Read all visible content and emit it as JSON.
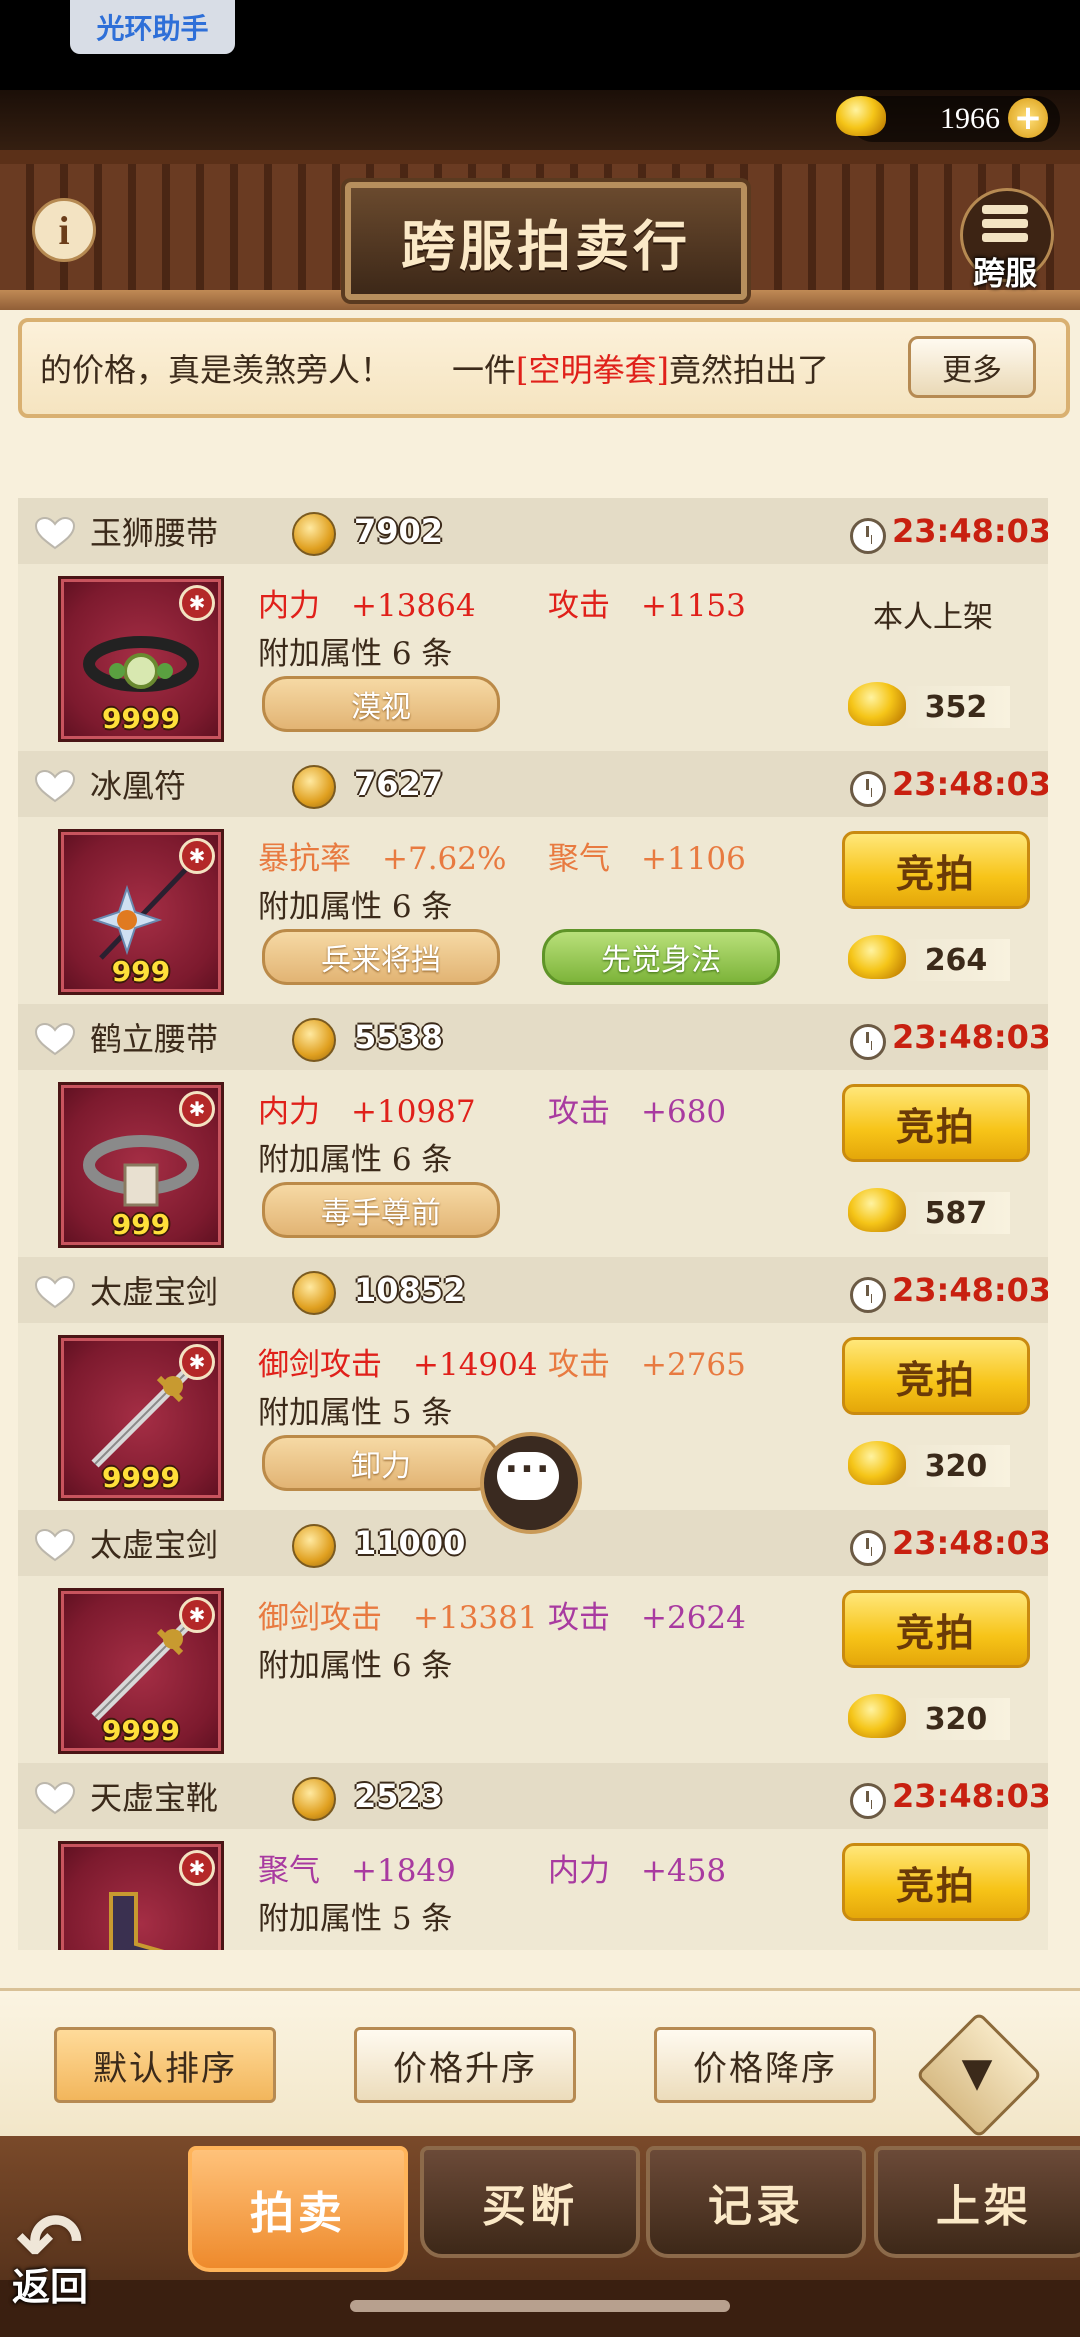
{
  "helper": "光环助手",
  "currency": {
    "gold": "1966",
    "plus": "+"
  },
  "header": {
    "title": "跨服拍卖行",
    "info": "i",
    "cross_server_label": "跨服"
  },
  "marquee": {
    "text_a": "的价格，真是羡煞旁人！",
    "text_b": "一件",
    "text_highlight": "[空明拳套]",
    "text_c": "竟然拍出了",
    "more_label": "更多"
  },
  "items": [
    {
      "name": "玉狮腰带",
      "price": "7902",
      "time": "23:48:03",
      "qty": "9999",
      "stat1": "内力　+13864",
      "stat1_color": "#e0201a",
      "stat2": "攻击　+1153",
      "stat2_color": "#e0201a",
      "extra": "附加属性 6 条",
      "tag1": "漠视",
      "tag2": "",
      "action": "本人上架",
      "bid_price": "352"
    },
    {
      "name": "冰凰符",
      "price": "7627",
      "time": "23:48:03",
      "qty": "999",
      "stat1": "暴抗率　+7.62%",
      "stat1_color": "#e87a40",
      "stat2": "聚气　+1106",
      "stat2_color": "#e87a40",
      "extra": "附加属性 6 条",
      "tag1": "兵来将挡",
      "tag2": "先觉身法",
      "action": "竞拍",
      "bid_price": "264"
    },
    {
      "name": "鹤立腰带",
      "price": "5538",
      "time": "23:48:03",
      "qty": "999",
      "stat1": "内力　+10987",
      "stat1_color": "#e0201a",
      "stat2": "攻击　+680",
      "stat2_color": "#a83aa0",
      "extra": "附加属性 6 条",
      "tag1": "毒手尊前",
      "tag2": "",
      "action": "竞拍",
      "bid_price": "587"
    },
    {
      "name": "太虚宝剑",
      "price": "10852",
      "time": "23:48:03",
      "qty": "9999",
      "stat1": "御剑攻击　+14904",
      "stat1_color": "#e0201a",
      "stat2": "攻击　+2765",
      "stat2_color": "#e87a40",
      "extra": "附加属性 5 条",
      "tag1": "卸力",
      "tag2": "",
      "action": "竞拍",
      "bid_price": "320"
    },
    {
      "name": "太虚宝剑",
      "price": "11000",
      "time": "23:48:03",
      "qty": "9999",
      "stat1": "御剑攻击　+13381",
      "stat1_color": "#e87a40",
      "stat2": "攻击　+2624",
      "stat2_color": "#a83aa0",
      "extra": "附加属性 6 条",
      "tag1": "",
      "tag2": "",
      "action": "竞拍",
      "bid_price": "320"
    },
    {
      "name": "天虚宝靴",
      "price": "2523",
      "time": "23:48:03",
      "qty": "",
      "stat1": "聚气　+1849",
      "stat1_color": "#a83aa0",
      "stat2": "内力　+458",
      "stat2_color": "#a83aa0",
      "extra": "附加属性 5 条",
      "tag1": "",
      "tag2": "",
      "action": "竞拍",
      "bid_price": ""
    }
  ],
  "sort": {
    "default": "默认排序",
    "asc": "价格升序",
    "desc": "价格降序"
  },
  "nav": {
    "auction": "拍卖",
    "buyout": "买断",
    "record": "记录",
    "list": "上架",
    "back": "返回"
  },
  "colors": {
    "accent_gold": "#f7c418",
    "price_red": "#c82010",
    "frame": "#b68a52"
  }
}
